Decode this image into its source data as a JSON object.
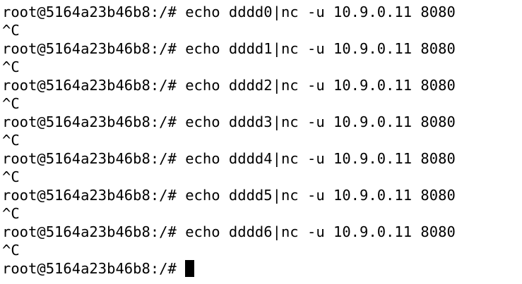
{
  "terminal": {
    "lines": [
      {
        "kind": "command",
        "prompt": "root@5164a23b46b8:/#",
        "command": "echo dddd0|nc -u 10.9.0.11 8080"
      },
      {
        "kind": "output",
        "text": "^C"
      },
      {
        "kind": "command",
        "prompt": "root@5164a23b46b8:/#",
        "command": "echo dddd1|nc -u 10.9.0.11 8080"
      },
      {
        "kind": "output",
        "text": "^C"
      },
      {
        "kind": "command",
        "prompt": "root@5164a23b46b8:/#",
        "command": "echo dddd2|nc -u 10.9.0.11 8080"
      },
      {
        "kind": "output",
        "text": "^C"
      },
      {
        "kind": "command",
        "prompt": "root@5164a23b46b8:/#",
        "command": "echo dddd3|nc -u 10.9.0.11 8080"
      },
      {
        "kind": "output",
        "text": "^C"
      },
      {
        "kind": "command",
        "prompt": "root@5164a23b46b8:/#",
        "command": "echo dddd4|nc -u 10.9.0.11 8080"
      },
      {
        "kind": "output",
        "text": "^C"
      },
      {
        "kind": "command",
        "prompt": "root@5164a23b46b8:/#",
        "command": "echo dddd5|nc -u 10.9.0.11 8080"
      },
      {
        "kind": "output",
        "text": "^C"
      },
      {
        "kind": "command",
        "prompt": "root@5164a23b46b8:/#",
        "command": "echo dddd6|nc -u 10.9.0.11 8080"
      },
      {
        "kind": "output",
        "text": "^C"
      },
      {
        "kind": "input",
        "prompt": "root@5164a23b46b8:/#",
        "command": ""
      }
    ],
    "colors": {
      "background": "#ffffff",
      "foreground": "#000000",
      "cursor": "#000000"
    }
  }
}
